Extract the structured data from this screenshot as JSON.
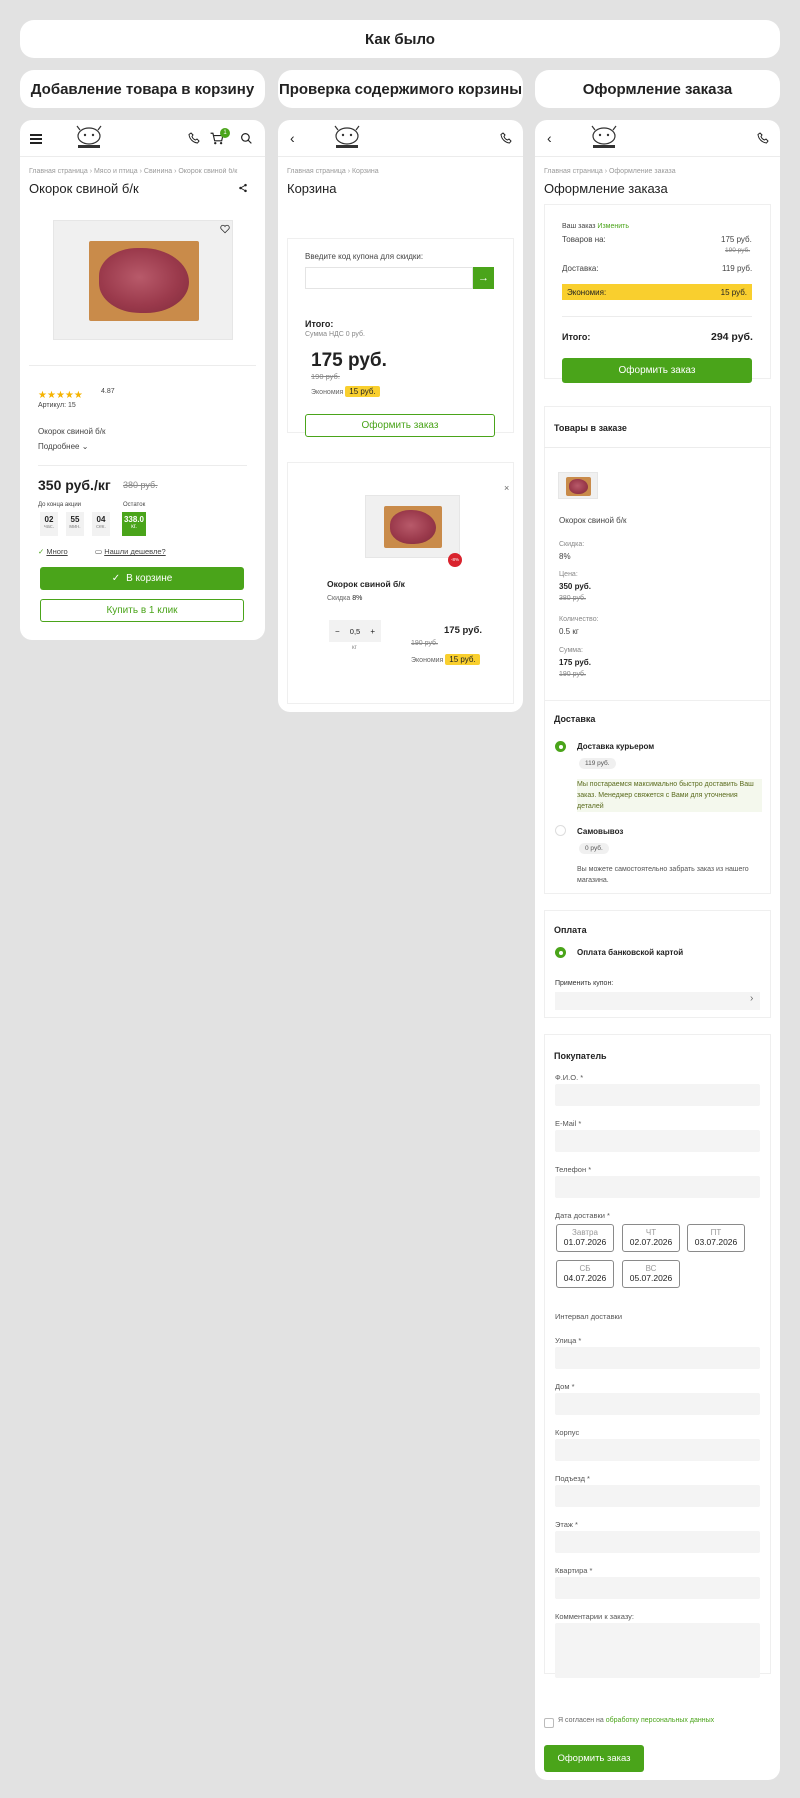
{
  "header": {
    "title": "Как было"
  },
  "columns": {
    "c1": "Добавление товара в корзину",
    "c2": "Проверка содержимого корзины",
    "c3": "Оформление заказа"
  },
  "colors": {
    "accent": "#4aa41a",
    "highlight": "#f9cf2e",
    "discount": "#d9232d"
  },
  "product": {
    "breadcrumb": "Главная страница  ›  Мясо и птица  ›  Свинина  ›  Окорок свиной б/к",
    "title": "Окорок свиной б/к",
    "rating": "4.87",
    "sku": "Артикул: 15",
    "name": "Окорок свиной б/к",
    "more": "Подробнее",
    "price": "350 руб./кг",
    "old_price": "380 руб.",
    "timer_label": "До конца акции",
    "stock_label": "Остаток",
    "timer": [
      {
        "n": "02",
        "u": "час."
      },
      {
        "n": "55",
        "u": "мин."
      },
      {
        "n": "04",
        "u": "сек."
      }
    ],
    "stock_value": "338.0",
    "stock_unit": "кг.",
    "many": "Много",
    "cheaper": "Нашли дешевле?",
    "in_cart_btn": "В корзине",
    "one_click_btn": "Купить в 1 клик",
    "cart_count": "1"
  },
  "cart": {
    "breadcrumb": "Главная страница  ›  Корзина",
    "title": "Корзина",
    "coupon_label": "Введите код купона для скидки:",
    "total_label": "Итого:",
    "vat": "Сумма НДС 0 руб.",
    "total": "175 руб.",
    "total_old": "190 руб.",
    "economy_label": "Экономия",
    "economy": "15 руб.",
    "order_btn": "Оформить заказ",
    "item_name": "Окорок свиной б/к",
    "discount_label": "Скидка",
    "discount": "8%",
    "discount_badge": "-8%",
    "qty": "0,5",
    "qty_unit": "кг",
    "item_price": "175 руб.",
    "item_old": "190 руб.",
    "item_economy": "15 руб."
  },
  "checkout": {
    "breadcrumb": "Главная страница  ›  Оформление заказа",
    "title": "Оформление заказа",
    "your_order": "Ваш заказ",
    "change": "Изменить",
    "goods_label": "Товаров на:",
    "goods": "175 руб.",
    "goods_old": "190 руб.",
    "delivery_label": "Доставка:",
    "delivery": "119 руб.",
    "economy_label": "Экономия:",
    "economy": "15 руб.",
    "total_label": "Итого:",
    "total": "294 руб.",
    "order_btn": "Оформить заказ",
    "items_title": "Товары в заказе",
    "item_name": "Окорок свиной б/к",
    "discount_label": "Скидка:",
    "discount": "8%",
    "price_label": "Цена:",
    "price": "350 руб.",
    "price_old": "380 руб.",
    "qty_label": "Количество:",
    "qty": "0.5 кг",
    "sum_label": "Сумма:",
    "sum": "175 руб.",
    "sum_old": "190 руб.",
    "delivery_title": "Доставка",
    "courier": "Доставка курьером",
    "courier_price": "119 руб.",
    "courier_note": "Мы постараемся максимально быстро доставить Ваш заказ. Менеджер свяжется с Вами для уточнения деталей",
    "pickup": "Самовывоз",
    "pickup_price": "0 руб.",
    "pickup_note": "Вы можете самостоятельно забрать заказ из нашего магазина.",
    "payment_title": "Оплата",
    "card_payment": "Оплата банковской картой",
    "apply_coupon": "Применить купон:",
    "buyer_title": "Покупатель",
    "fio": "Ф.И.О. *",
    "email": "E-Mail *",
    "phone": "Телефон *",
    "delivery_date": "Дата доставки *",
    "dates": [
      {
        "d": "Завтра",
        "v": "01.07.2026"
      },
      {
        "d": "ЧТ",
        "v": "02.07.2026"
      },
      {
        "d": "ПТ",
        "v": "03.07.2026"
      },
      {
        "d": "СБ",
        "v": "04.07.2026"
      },
      {
        "d": "ВС",
        "v": "05.07.2026"
      }
    ],
    "interval": "Интервал доставки",
    "street": "Улица *",
    "house": "Дом *",
    "building": "Корпус",
    "entrance": "Подъезд *",
    "floor": "Этаж *",
    "apartment": "Квартира *",
    "comment": "Комментарии к заказу:",
    "agree_text": "Я согласен на",
    "agree_link": "обработку персональных данных",
    "submit": "Оформить заказ"
  }
}
